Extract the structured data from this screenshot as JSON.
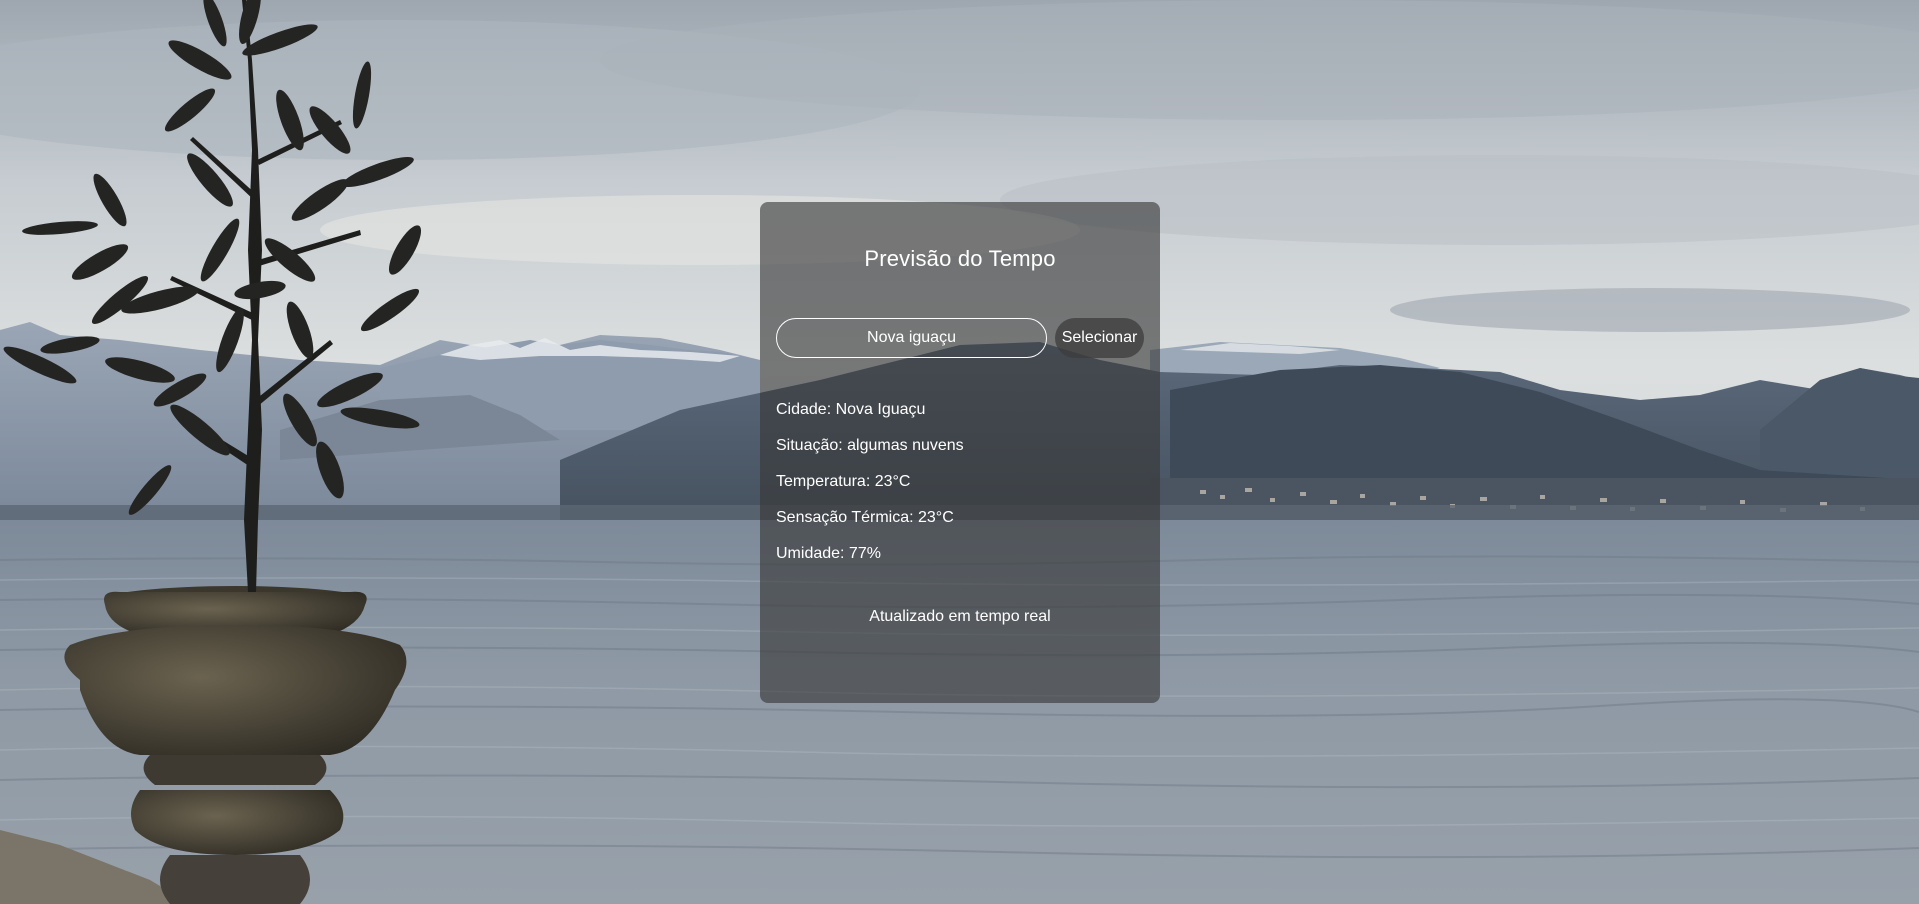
{
  "app": {
    "title": "Previsão do Tempo"
  },
  "search": {
    "value": "Nova iguaçu",
    "button_label": "Selecionar"
  },
  "weather": {
    "city": "Cidade: Nova Iguaçu",
    "condition": "Situação: algumas nuvens",
    "temperature": "Temperatura: 23°C",
    "feels_like": "Sensação Térmica: 23°C",
    "humidity": "Umidade: 77%"
  },
  "footer": {
    "note": "Atualizado em tempo real"
  },
  "background": {
    "scene": "lake-mountains-photo",
    "icons": [
      "plant-pot-image"
    ]
  },
  "colors": {
    "card_bg": "#373737",
    "text": "#ffffff",
    "sky": "#c9cdd2",
    "water": "#8a96a3"
  }
}
